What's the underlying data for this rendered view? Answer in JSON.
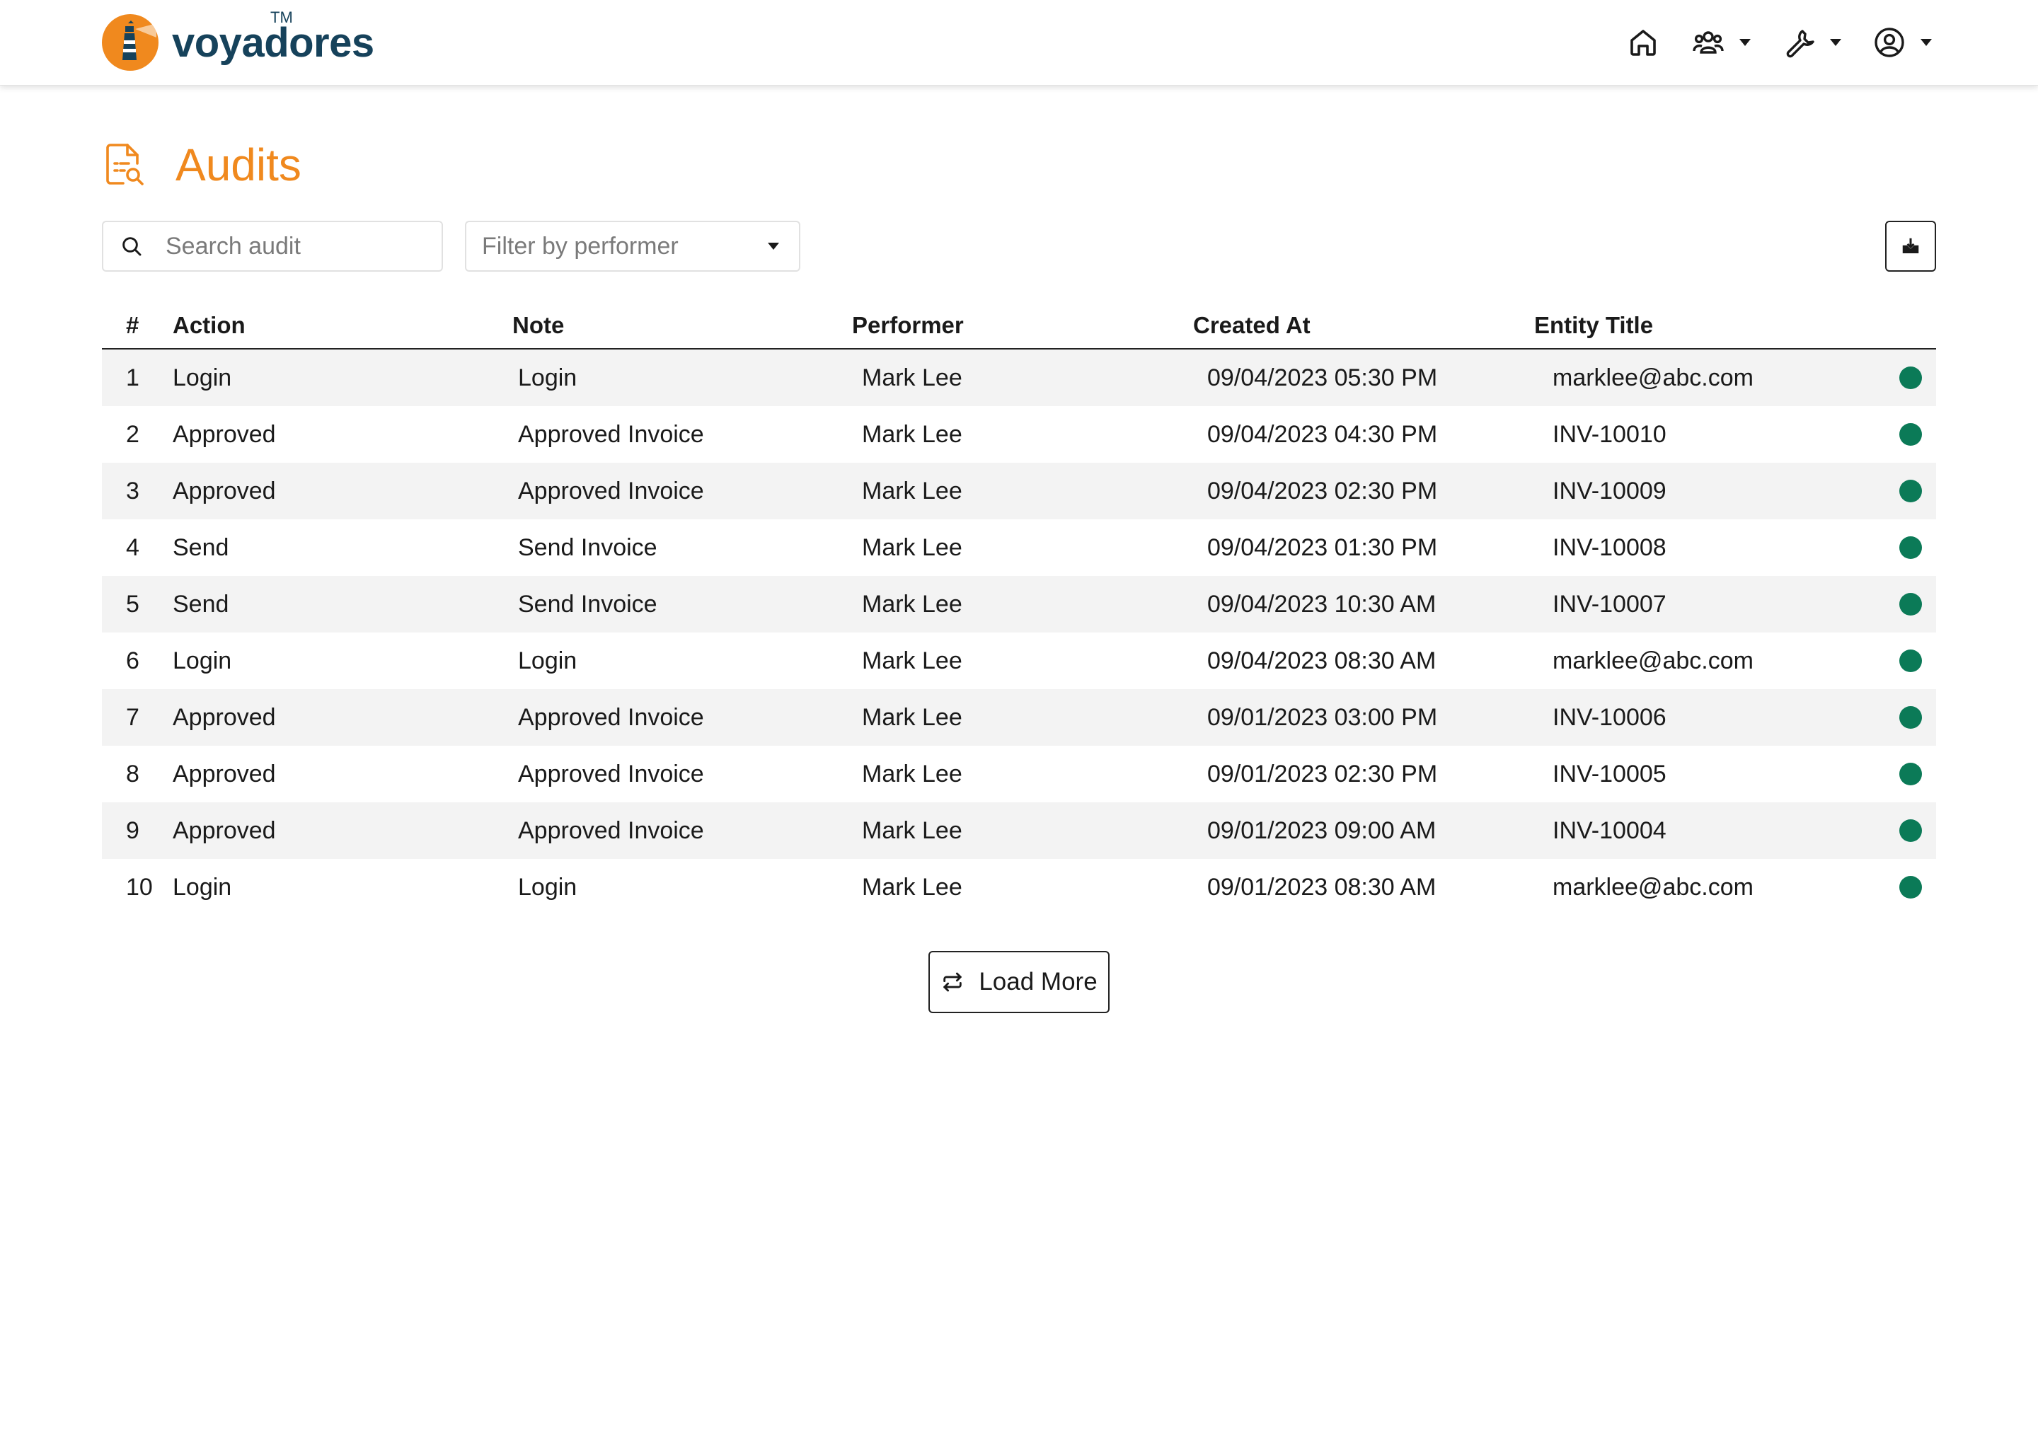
{
  "header": {
    "brand": "voyadores",
    "trademark": "TM",
    "nav": [
      {
        "icon": "home-icon"
      },
      {
        "icon": "users-icon",
        "dropdown": true
      },
      {
        "icon": "wrench-icon",
        "dropdown": true
      },
      {
        "icon": "user-circle-icon",
        "dropdown": true
      }
    ]
  },
  "page": {
    "title": "Audits",
    "search_placeholder": "Search audit",
    "filter_placeholder": "Filter by performer",
    "load_more_label": "Load More"
  },
  "table": {
    "columns": [
      "#",
      "Action",
      "Note",
      "Performer",
      "Created At",
      "Entity Title"
    ],
    "rows": [
      {
        "idx": "1",
        "action": "Login",
        "note": "Login",
        "performer": "Mark Lee",
        "created": "09/04/2023 05:30 PM",
        "entity": "marklee@abc.com"
      },
      {
        "idx": "2",
        "action": "Approved",
        "note": "Approved Invoice",
        "performer": "Mark Lee",
        "created": "09/04/2023 04:30 PM",
        "entity": "INV-10010"
      },
      {
        "idx": "3",
        "action": "Approved",
        "note": "Approved Invoice",
        "performer": "Mark Lee",
        "created": "09/04/2023 02:30 PM",
        "entity": "INV-10009"
      },
      {
        "idx": "4",
        "action": "Send",
        "note": "Send Invoice",
        "performer": "Mark Lee",
        "created": "09/04/2023 01:30 PM",
        "entity": "INV-10008"
      },
      {
        "idx": "5",
        "action": "Send",
        "note": "Send Invoice",
        "performer": "Mark Lee",
        "created": "09/04/2023 10:30 AM",
        "entity": "INV-10007"
      },
      {
        "idx": "6",
        "action": "Login",
        "note": "Login",
        "performer": "Mark Lee",
        "created": "09/04/2023 08:30 AM",
        "entity": "marklee@abc.com"
      },
      {
        "idx": "7",
        "action": "Approved",
        "note": "Approved Invoice",
        "performer": "Mark Lee",
        "created": "09/01/2023 03:00 PM",
        "entity": "INV-10006"
      },
      {
        "idx": "8",
        "action": "Approved",
        "note": "Approved Invoice",
        "performer": "Mark Lee",
        "created": "09/01/2023 02:30 PM",
        "entity": "INV-10005"
      },
      {
        "idx": "9",
        "action": "Approved",
        "note": "Approved Invoice",
        "performer": "Mark Lee",
        "created": "09/01/2023 09:00 AM",
        "entity": "INV-10004"
      },
      {
        "idx": "10",
        "action": "Login",
        "note": "Login",
        "performer": "Mark Lee",
        "created": "09/01/2023 08:30 AM",
        "entity": "marklee@abc.com"
      }
    ]
  },
  "colors": {
    "accent": "#f0891e",
    "brand": "#16425b",
    "status_ok": "#0b7a57"
  }
}
